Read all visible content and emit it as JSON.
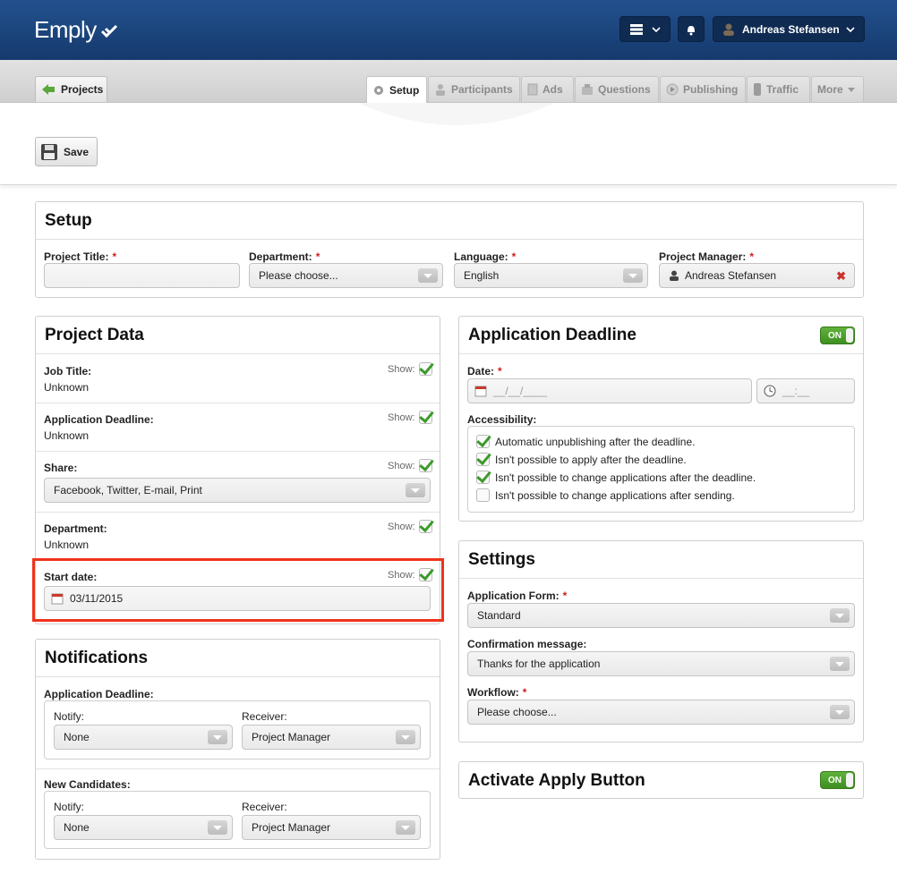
{
  "header": {
    "logo": "Emply",
    "user_name": "Andreas Stefansen"
  },
  "nav": {
    "projects_label": "Projects",
    "tabs": [
      {
        "label": "Setup",
        "icon": "gear-icon"
      },
      {
        "label": "Participants",
        "icon": "person-icon"
      },
      {
        "label": "Ads",
        "icon": "document-icon"
      },
      {
        "label": "Questions",
        "icon": "questions-icon"
      },
      {
        "label": "Publishing",
        "icon": "play-icon"
      },
      {
        "label": "Traffic",
        "icon": "traffic-icon"
      },
      {
        "label": "More"
      }
    ]
  },
  "toolbar": {
    "save_label": "Save"
  },
  "setup": {
    "title": "Setup",
    "project_title_label": "Project Title:",
    "project_title_value": "",
    "department_label": "Department:",
    "department_value": "Please choose...",
    "language_label": "Language:",
    "language_value": "English",
    "manager_label": "Project Manager:",
    "manager_value": "Andreas Stefansen"
  },
  "project_data": {
    "title": "Project Data",
    "show_label": "Show:",
    "job_title_label": "Job Title:",
    "job_title_value": "Unknown",
    "deadline_label": "Application Deadline:",
    "deadline_value": "Unknown",
    "share_label": "Share:",
    "share_value": "Facebook, Twitter, E-mail, Print",
    "department_label": "Department:",
    "department_value": "Unknown",
    "start_label": "Start date:",
    "start_value": "03/11/2015"
  },
  "notifications": {
    "title": "Notifications",
    "deadline_label": "Application Deadline:",
    "new_candidates_label": "New Candidates:",
    "notify_label": "Notify:",
    "receiver_label": "Receiver:",
    "notify_value": "None",
    "receiver_value": "Project Manager"
  },
  "app_deadline": {
    "title": "Application Deadline",
    "toggle": "ON",
    "date_label": "Date:",
    "date_placeholder": "__/__/____",
    "time_placeholder": "__:__",
    "accessibility_label": "Accessibility:",
    "options": [
      {
        "label": "Automatic unpublishing after the deadline.",
        "checked": true
      },
      {
        "label": "Isn't possible to apply after the deadline.",
        "checked": true
      },
      {
        "label": "Isn't possible to change applications after the deadline.",
        "checked": true
      },
      {
        "label": "Isn't possible to change applications after sending.",
        "checked": false
      }
    ]
  },
  "settings": {
    "title": "Settings",
    "form_label": "Application Form:",
    "form_value": "Standard",
    "confirm_label": "Confirmation message:",
    "confirm_value": "Thanks for the application",
    "workflow_label": "Workflow:",
    "workflow_value": "Please choose..."
  },
  "apply_button": {
    "title": "Activate Apply Button",
    "toggle": "ON"
  },
  "colors": {
    "header": "#1d4a84",
    "required": "#d21d1d",
    "toggle_on": "#4ea22e",
    "highlight": "#f0321a"
  }
}
